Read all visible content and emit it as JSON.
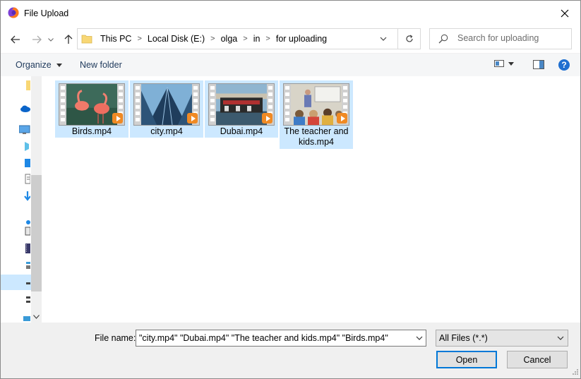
{
  "window": {
    "title": "File Upload"
  },
  "nav": {
    "breadcrumbs": [
      "This PC",
      "Local Disk (E:)",
      "olga",
      "in",
      "for uploading"
    ],
    "search_placeholder": "Search for uploading"
  },
  "commandbar": {
    "organize_label": "Organize",
    "new_folder_label": "New folder",
    "help_label": "?"
  },
  "files": [
    {
      "name": "Birds.mp4",
      "lines": [
        "Birds.mp4"
      ],
      "thumb": "flamingos"
    },
    {
      "name": "city.mp4",
      "lines": [
        "city.mp4"
      ],
      "thumb": "skyscraper"
    },
    {
      "name": "Dubai.mp4",
      "lines": [
        "Dubai.mp4"
      ],
      "thumb": "boat"
    },
    {
      "name": "The teacher and kids.mp4",
      "lines": [
        "The teacher and",
        "kids.mp4"
      ],
      "thumb": "classroom"
    }
  ],
  "bottom": {
    "file_name_label": "File name:",
    "file_name_value": "\"city.mp4\" \"Dubai.mp4\" \"The teacher and kids.mp4\" \"Birds.mp4\"",
    "filter_value": "All Files (*.*)",
    "open_label": "Open",
    "cancel_label": "Cancel"
  },
  "colors": {
    "selection": "#cce8ff",
    "accent": "#0078d7",
    "play_badge": "#f08a24"
  }
}
